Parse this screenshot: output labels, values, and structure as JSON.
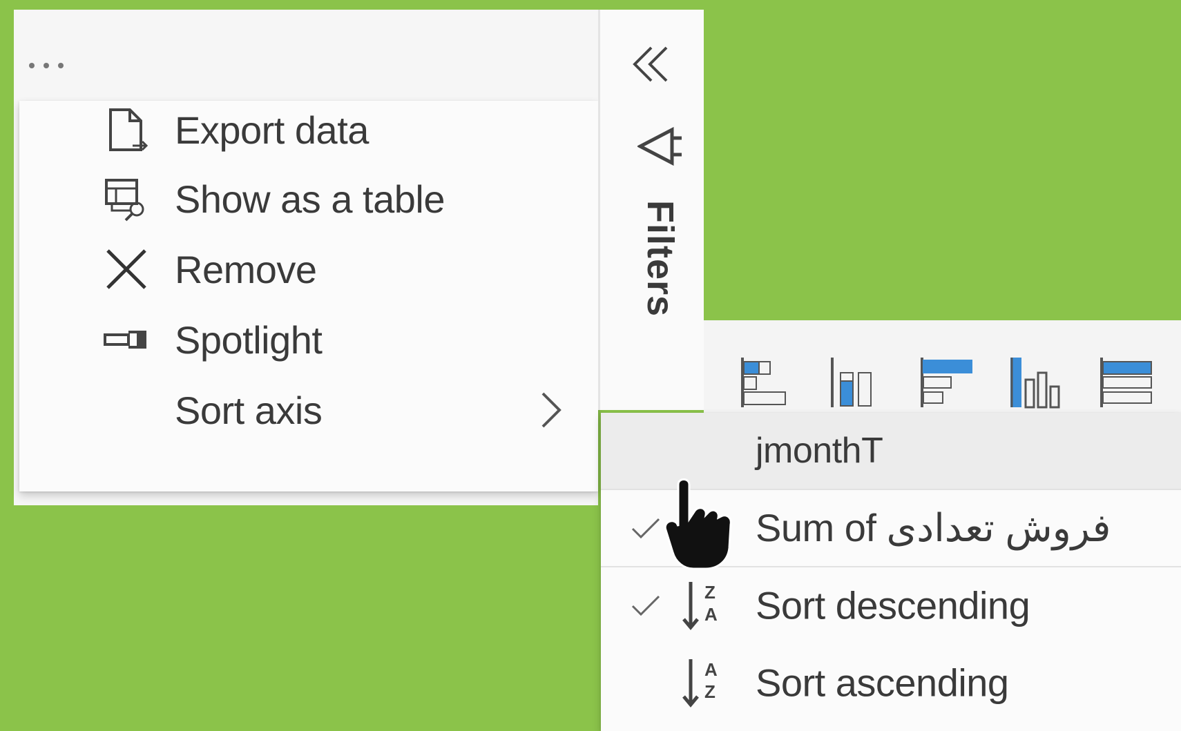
{
  "visual": {
    "more_options_icon": "more-options-icon"
  },
  "context_menu": {
    "items": [
      {
        "label": "Export data",
        "icon": "export-data-icon"
      },
      {
        "label": "Show as a table",
        "icon": "show-as-table-icon"
      },
      {
        "label": "Remove",
        "icon": "close-icon"
      },
      {
        "label": "Spotlight",
        "icon": "spotlight-icon"
      },
      {
        "label": "Sort axis",
        "icon": "chevron-right-icon"
      }
    ]
  },
  "filters_pane": {
    "label": "Filters",
    "collapse_icon": "double-chevron-left-icon",
    "filter_icon": "funnel-icon"
  },
  "sort_submenu": {
    "items": [
      {
        "label": "jmonthT",
        "checked": false,
        "highlighted": true
      },
      {
        "label": "Sum of فروش تعدادی",
        "checked": true,
        "highlighted": false
      },
      {
        "label": "Sort descending",
        "checked": true,
        "icon": "sort-descending-icon"
      },
      {
        "label": "Sort ascending",
        "checked": false,
        "icon": "sort-ascending-icon"
      }
    ]
  },
  "colors": {
    "background": "#8bc34a",
    "accent_blue": "#3b8ed8",
    "menu_bg": "#fbfbfb"
  }
}
